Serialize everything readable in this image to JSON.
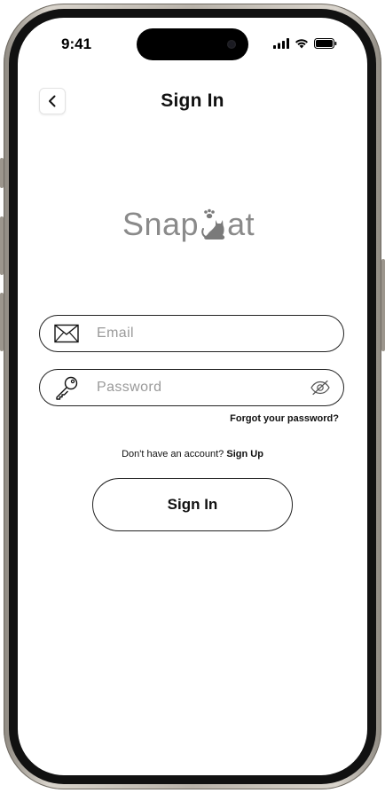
{
  "status_bar": {
    "time": "9:41"
  },
  "header": {
    "title": "Sign In",
    "back_icon": "chevron-left-icon"
  },
  "logo": {
    "text_left": "Snap",
    "text_right": "at",
    "icon": "cat-paw-icon"
  },
  "email": {
    "placeholder": "Email",
    "icon": "envelope-icon"
  },
  "password": {
    "placeholder": "Password",
    "icon": "key-icon",
    "toggle_icon": "eye-off-icon"
  },
  "forgot_label": "Forgot your password?",
  "signup": {
    "prompt": "Don't have an account?",
    "link": "Sign Up"
  },
  "submit_label": "Sign In"
}
